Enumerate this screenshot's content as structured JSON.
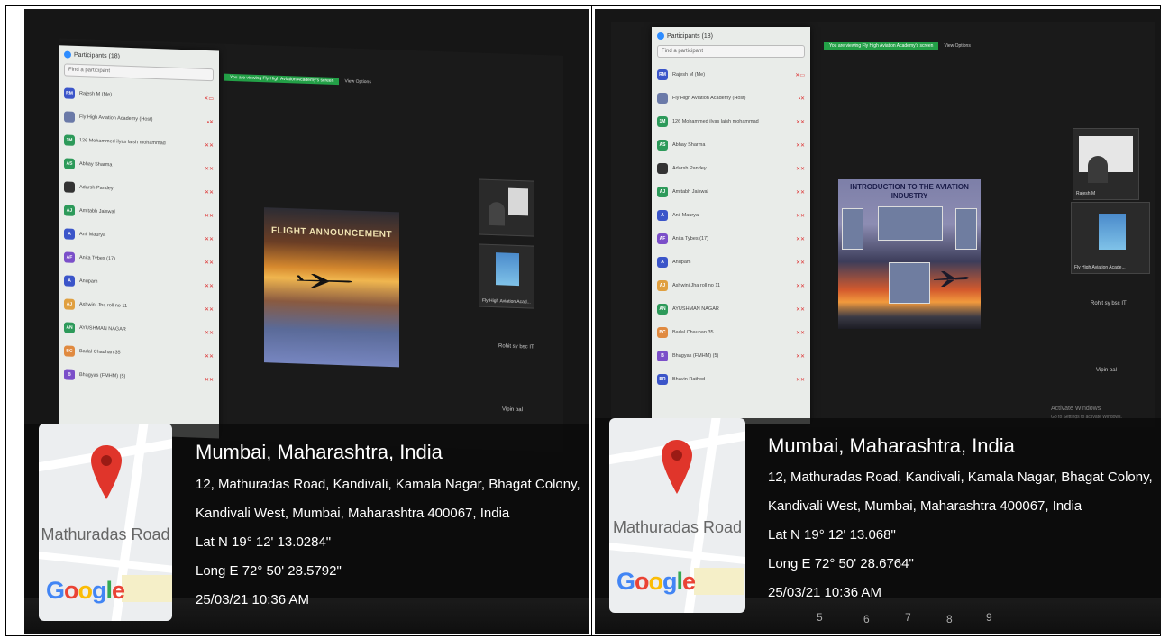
{
  "left": {
    "zoom": {
      "panel_title": "Participants (18)",
      "search_placeholder": "Find a participant",
      "view_banner": "You are viewing Fly High Aviation Academy's screen",
      "view_options": "View Options",
      "participants": [
        {
          "initials": "RM",
          "name": "Rajesh M (Me)",
          "color": "#3b55c9"
        },
        {
          "initials": "",
          "name": "Fly High Aviation Academy (Host)",
          "color": "#6b7aa8"
        },
        {
          "initials": "1M",
          "name": "126 Mohammed ilyas laish mohammad",
          "color": "#2d9a5a"
        },
        {
          "initials": "AS",
          "name": "Abhay Sharma",
          "color": "#2d9a5a"
        },
        {
          "initials": "",
          "name": "Adarsh Pandey",
          "color": "#333333"
        },
        {
          "initials": "AJ",
          "name": "Amitabh Jaiswal",
          "color": "#2d9a5a"
        },
        {
          "initials": "A",
          "name": "Anil Maurya",
          "color": "#3b55c9"
        },
        {
          "initials": "AF",
          "name": "Anita Tybes (17)",
          "color": "#7b4fc9"
        },
        {
          "initials": "A",
          "name": "Anupam",
          "color": "#3b55c9"
        },
        {
          "initials": "AJ",
          "name": "Ashwini Jha roll no 11",
          "color": "#e0a040"
        },
        {
          "initials": "AN",
          "name": "AYUSHMAN NAGAR",
          "color": "#2d9a5a"
        },
        {
          "initials": "BC",
          "name": "Badal Chauhan 35",
          "color": "#e08a40"
        },
        {
          "initials": "B",
          "name": "Bhagyas (FMHM) (5)",
          "color": "#7b4fc9"
        }
      ],
      "slide_title": "FLIGHT ANNOUNCEMENT",
      "tile_label": "Fly High Aviation Acad...",
      "side_names": [
        "Rohit sy bsc IT",
        "Vipin pal"
      ]
    },
    "geo": {
      "city": "Mumbai, Maharashtra, India",
      "address_line1": "12, Mathuradas Road, Kandivali, Kamala Nagar, Bhagat Colony,",
      "address_line2": "Kandivali West, Mumbai, Maharashtra 400067, India",
      "lat": "Lat N 19° 12' 13.0284\"",
      "long": "Long E 72° 50' 28.5792\"",
      "datetime": "25/03/21 10:36 AM",
      "map_label": "Mathuradas Road",
      "brand": "Google"
    }
  },
  "right": {
    "zoom": {
      "panel_title": "Participants (18)",
      "search_placeholder": "Find a participant",
      "view_banner": "You are viewing Fly High Aviation Academy's screen",
      "view_options": "View Options",
      "participants": [
        {
          "initials": "RM",
          "name": "Rajesh M (Me)",
          "color": "#3b55c9"
        },
        {
          "initials": "",
          "name": "Fly High Aviation Academy (Host)",
          "color": "#6b7aa8"
        },
        {
          "initials": "1M",
          "name": "126 Mohammed ilyas laish mohammad",
          "color": "#2d9a5a"
        },
        {
          "initials": "AS",
          "name": "Abhay Sharma",
          "color": "#2d9a5a"
        },
        {
          "initials": "",
          "name": "Adarsh Pandey",
          "color": "#333333"
        },
        {
          "initials": "AJ",
          "name": "Amitabh Jaiswal",
          "color": "#2d9a5a"
        },
        {
          "initials": "A",
          "name": "Anil Maurya",
          "color": "#3b55c9"
        },
        {
          "initials": "AF",
          "name": "Anita Tybes (17)",
          "color": "#7b4fc9"
        },
        {
          "initials": "A",
          "name": "Anupam",
          "color": "#3b55c9"
        },
        {
          "initials": "AJ",
          "name": "Ashwini Jha roll no 11",
          "color": "#e0a040"
        },
        {
          "initials": "AN",
          "name": "AYUSHMAN NAGAR",
          "color": "#2d9a5a"
        },
        {
          "initials": "BC",
          "name": "Badal Chauhan 35",
          "color": "#e08a40"
        },
        {
          "initials": "B",
          "name": "Bhagyas (FMHM) (5)",
          "color": "#7b4fc9"
        },
        {
          "initials": "BR",
          "name": "Bhavin Rathod",
          "color": "#3b55c9"
        }
      ],
      "slide_title": "INTRODUCTION TO THE AVIATION INDUSTRY",
      "tile_label": "Fly High Aviation Acade...",
      "tile_top_label": "Rajesh M",
      "side_names": [
        "Rohit sy bsc IT",
        "Vipin pal"
      ],
      "watermark": [
        "Activate Windows",
        "Go to Settings to activate Windows."
      ]
    },
    "geo": {
      "city": "Mumbai, Maharashtra, India",
      "address_line1": "12, Mathuradas Road, Kandivali, Kamala Nagar, Bhagat Colony,",
      "address_line2": "Kandivali West, Mumbai, Maharashtra 400067, India",
      "lat": "Lat N 19° 12' 13.068\"",
      "long": "Long E 72° 50' 28.6764\"",
      "datetime": "25/03/21 10:36 AM",
      "map_label": "Mathuradas Road",
      "brand": "Google"
    }
  },
  "colors": {
    "zoom_blue": "#2d8cff",
    "banner_green": "#23a047",
    "pin_red": "#e0352b"
  }
}
